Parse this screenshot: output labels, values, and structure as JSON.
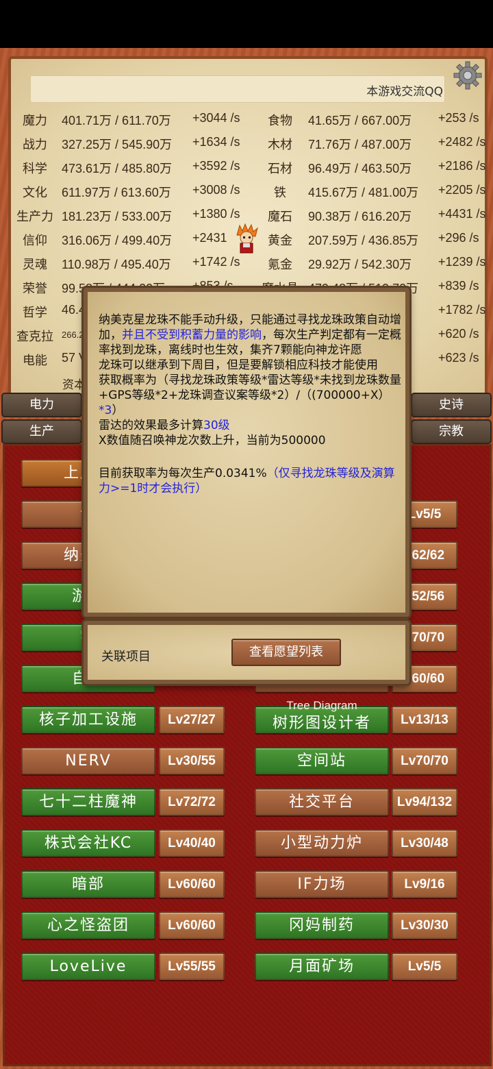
{
  "header": {
    "banner": "本游戏交流QQ"
  },
  "resources": [
    {
      "n1": "魔力",
      "v1": "401.71万 / 611.70万",
      "r1": "+3044 /s",
      "n2": "食物",
      "v2": "41.65万 / 667.00万",
      "r2": "+253 /s"
    },
    {
      "n1": "战力",
      "v1": "327.25万 / 545.90万",
      "r1": "+1634 /s",
      "n2": "木材",
      "v2": "71.76万 / 487.00万",
      "r2": "+2482 /s"
    },
    {
      "n1": "科学",
      "v1": "473.61万 / 485.80万",
      "r1": "+3592 /s",
      "n2": "石材",
      "v2": "96.49万 / 463.50万",
      "r2": "+2186 /s"
    },
    {
      "n1": "文化",
      "v1": "611.97万 / 613.60万",
      "r1": "+3008 /s",
      "n2": "铁",
      "v2": "415.67万 / 481.00万",
      "r2": "+2205 /s"
    },
    {
      "n1": "生产力",
      "v1": "181.23万 / 533.00万",
      "r1": "+1380 /s",
      "n2": "魔石",
      "v2": "90.38万 / 616.20万",
      "r2": "+4431 /s"
    },
    {
      "n1": "信仰",
      "v1": "316.06万 / 499.40万",
      "r1": "+2431",
      "n2": "黄金",
      "v2": "207.59万 / 436.85万",
      "r2": "+296 /s"
    },
    {
      "n1": "灵魂",
      "v1": "110.98万 / 495.40万",
      "r1": "+1742 /s",
      "n2": "氪金",
      "v2": "29.92万 / 542.30万",
      "r2": "+1239 /s"
    },
    {
      "n1": "荣誉",
      "v1": "99.58万 / 444.00万",
      "r1": "+853 /s",
      "n2": "魔水晶",
      "v2": "479.48万 / 519.70万",
      "r2": "+839 /s"
    },
    {
      "n1": "哲学",
      "v1": "46.4",
      "r1": "",
      "n2": "",
      "v2": "0万",
      "r2": "+1782 /s"
    },
    {
      "n1": "查克拉",
      "v1": "266.2",
      "r1": "",
      "n2": "",
      "v2": "0万",
      "r2": "+620 /s"
    },
    {
      "n1": "电能",
      "v1": "57 V",
      "r1": "",
      "n2": "",
      "v2": "万",
      "r2": "+623 /s"
    }
  ],
  "capital_label": "资本",
  "side_tabs": {
    "electric": "电力",
    "production": "生产",
    "epic": "史诗",
    "religion": "宗教"
  },
  "popup": {
    "p1a": "纳美克星龙珠不能手动升级，只能通过寻找龙珠政策自动增加，",
    "p1b": "并且不受到积蓄力量的影响",
    "p1c": "，每次生产判定都有一定概率找到龙珠，离线时也生效，集齐7颗能向神龙许愿",
    "p2": "龙珠可以继承到下周目，但是要解锁相应科技才能使用",
    "p3a": "获取概率为（寻找龙珠政策等级*雷达等级*未找到龙珠数量+GPS等级*2+龙珠调查议案等级*2）/（(700000+X）",
    "p3b": "*3",
    "p3c": "）",
    "p4a": "雷达的效果最多计算",
    "p4b": "30级",
    "p5": "X数值随召唤神龙次数上升，当前为500000",
    "p6a": "目前获取率为每次生产0.0341%",
    "p6b": "（仅寻找龙珠等级及演算力>=1时才会执行）",
    "related": "关联项目",
    "wish_button": "查看愿望列表"
  },
  "items_left": [
    {
      "label": "上屏显",
      "lvl": ""
    },
    {
      "label": "计",
      "lvl": ""
    },
    {
      "label": "纳美克",
      "lvl": ""
    },
    {
      "label": "游戏",
      "lvl": ""
    },
    {
      "label": "宇",
      "lvl": ""
    },
    {
      "label": "自由",
      "lvl": ""
    },
    {
      "label": "核子加工设施",
      "lvl": "Lv27/27"
    },
    {
      "label": "NERV",
      "lvl": "Lv30/55"
    },
    {
      "label": "七十二柱魔神",
      "lvl": "Lv72/72"
    },
    {
      "label": "株式会社KC",
      "lvl": "Lv40/40"
    },
    {
      "label": "暗部",
      "lvl": "Lv60/60"
    },
    {
      "label": "心之怪盗团",
      "lvl": "Lv60/60"
    },
    {
      "label": "LoveLive",
      "lvl": "Lv55/55"
    }
  ],
  "items_right": [
    {
      "label": "",
      "lvl": "Lv5/5"
    },
    {
      "label": "",
      "lvl": "v62/62"
    },
    {
      "label": "",
      "lvl": "v52/56"
    },
    {
      "label": "",
      "lvl": "v70/70"
    },
    {
      "label": "",
      "lvl": "v60/60"
    },
    {
      "label": "树形图设计者",
      "lvl": "Lv13/13",
      "caption": "Tree Diagram"
    },
    {
      "label": "空间站",
      "lvl": "Lv70/70"
    },
    {
      "label": "社交平台",
      "lvl": "Lv94/132"
    },
    {
      "label": "小型动力炉",
      "lvl": "Lv30/48"
    },
    {
      "label": "IF力场",
      "lvl": "Lv9/16"
    },
    {
      "label": "冈妈制药",
      "lvl": "Lv30/30"
    },
    {
      "label": "月面矿场",
      "lvl": "Lv5/5"
    }
  ]
}
